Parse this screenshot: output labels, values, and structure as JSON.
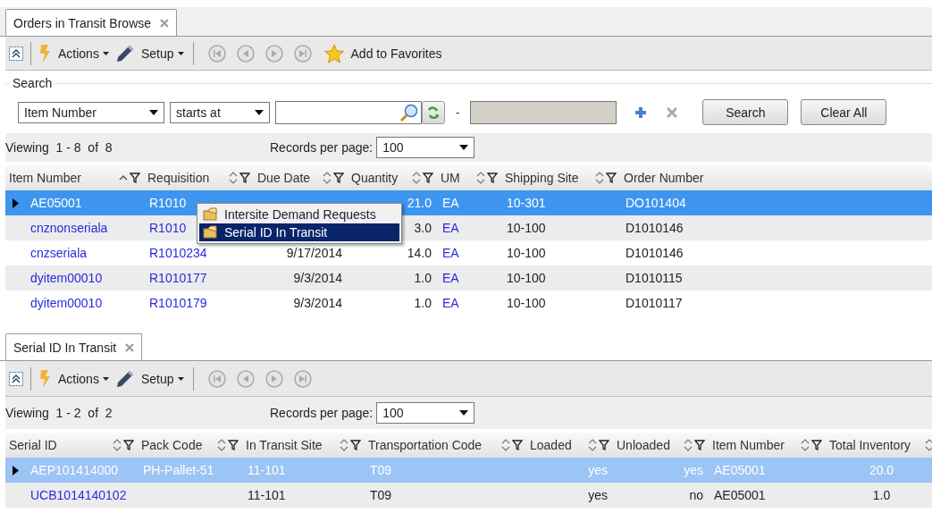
{
  "top_panel": {
    "tab": {
      "label": "Orders in Transit Browse"
    },
    "toolbar": {
      "actions": "Actions",
      "setup": "Setup",
      "favorites": "Add to Favorites"
    },
    "search": {
      "title": "Search",
      "field": "Item Number",
      "operator": "starts at",
      "dash": "-",
      "search_button": "Search",
      "clear_button": "Clear All"
    },
    "viewing": "Viewing  1 - 8  of  8",
    "records_label": "Records per page:",
    "records_value": "100",
    "table": {
      "columns": [
        {
          "label": "Item Number",
          "sortable": true,
          "sorted": true,
          "filter": true,
          "link": true
        },
        {
          "label": "Requisition",
          "sortable": true,
          "sorted": false,
          "filter": true,
          "link": true
        },
        {
          "label": "Due Date",
          "sortable": true,
          "sorted": false,
          "filter": true,
          "link": false
        },
        {
          "label": "Quantity",
          "sortable": true,
          "sorted": false,
          "filter": true,
          "link": false
        },
        {
          "label": "UM",
          "sortable": true,
          "sorted": false,
          "filter": true,
          "link": true
        },
        {
          "label": "Shipping Site",
          "sortable": true,
          "sorted": false,
          "filter": true,
          "link": false
        },
        {
          "label": "Order Number",
          "sortable": false,
          "filter": false,
          "link": false
        }
      ],
      "rows": [
        {
          "selected": true,
          "cells": [
            "AE05001",
            "R1010",
            "",
            "21.0",
            "EA",
            "10-301",
            "DO101404"
          ]
        },
        {
          "selected": false,
          "cells": [
            "cnznonseriala",
            "R1010",
            "",
            "3.0",
            "EA",
            "10-100",
            "D1010146"
          ]
        },
        {
          "selected": false,
          "cells": [
            "cnzseriala",
            "R1010234",
            "9/17/2014",
            "14.0",
            "EA",
            "10-100",
            "D1010146"
          ]
        },
        {
          "selected": false,
          "cells": [
            "dyitem00010",
            "R1010177",
            "9/3/2014",
            "1.0",
            "EA",
            "10-100",
            "D1010115"
          ]
        },
        {
          "selected": false,
          "cells": [
            "dyitem00010",
            "R1010179",
            "9/3/2014",
            "1.0",
            "EA",
            "10-100",
            "D1010117"
          ]
        }
      ]
    },
    "context_menu": {
      "items": [
        {
          "label": "Intersite Demand Requests",
          "selected": false
        },
        {
          "label": "Serial ID In Transit",
          "selected": true
        }
      ]
    }
  },
  "bottom_panel": {
    "tab": {
      "label": "Serial ID In Transit"
    },
    "toolbar": {
      "actions": "Actions",
      "setup": "Setup"
    },
    "viewing": "Viewing  1 - 2  of  2",
    "records_label": "Records per page:",
    "records_value": "100",
    "table": {
      "columns": [
        {
          "label": "Serial ID",
          "sortable": true,
          "sorted": false,
          "filter": true,
          "link": true
        },
        {
          "label": "Pack Code",
          "sortable": true,
          "sorted": false,
          "filter": true,
          "link": false
        },
        {
          "label": "In Transit Site",
          "sortable": true,
          "sorted": false,
          "filter": true,
          "link": false
        },
        {
          "label": "Transportation Code",
          "sortable": true,
          "sorted": false,
          "filter": true,
          "link": false
        },
        {
          "label": "Loaded",
          "sortable": true,
          "sorted": false,
          "filter": true,
          "link": false
        },
        {
          "label": "Unloaded",
          "sortable": true,
          "sorted": false,
          "filter": true,
          "link": false
        },
        {
          "label": "Item Number",
          "sortable": true,
          "sorted": false,
          "filter": true,
          "link": false
        },
        {
          "label": "Total Inventory",
          "sortable": true,
          "sorted": false,
          "filter": false,
          "link": false
        }
      ],
      "rows": [
        {
          "selected": true,
          "cells": [
            "AEP101414000",
            "PH-Pallet-51",
            "11-101",
            "T09",
            "yes",
            "yes",
            "AE05001",
            "20.0"
          ]
        },
        {
          "selected": false,
          "cells": [
            "UCB1014140102",
            "",
            "11-101",
            "T09",
            "yes",
            "no",
            "AE05001",
            "1.0"
          ]
        }
      ]
    }
  }
}
